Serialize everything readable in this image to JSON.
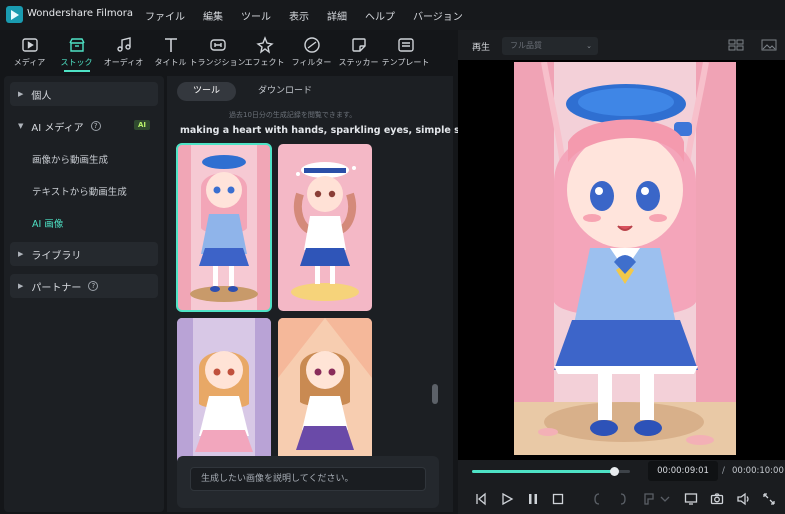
{
  "app": {
    "name": "Wondershare Filmora"
  },
  "menu": [
    "ファイル",
    "編集",
    "ツール",
    "表示",
    "詳細",
    "ヘルプ",
    "バージョン"
  ],
  "toolbar": [
    {
      "label": "メディア",
      "icon": "media-icon"
    },
    {
      "label": "ストック",
      "icon": "stock-icon",
      "active": true
    },
    {
      "label": "オーディオ",
      "icon": "audio-icon"
    },
    {
      "label": "タイトル",
      "icon": "title-icon"
    },
    {
      "label": "トランジション",
      "icon": "transition-icon"
    },
    {
      "label": "エフェクト",
      "icon": "effect-icon"
    },
    {
      "label": "フィルター",
      "icon": "filter-icon"
    },
    {
      "label": "ステッカー",
      "icon": "sticker-icon"
    },
    {
      "label": "テンプレート",
      "icon": "template-icon"
    }
  ],
  "nav": {
    "personal": "個人",
    "ai_media": "AI メディア",
    "ai_badge": "AI",
    "sub_items": [
      "画像から動画生成",
      "テキストから動画生成",
      "AI 画像"
    ],
    "active_sub": "AI 画像",
    "library": "ライブラリ",
    "partner": "パートナー"
  },
  "panel": {
    "tabs": [
      "ツール",
      "ダウンロード"
    ],
    "active_tab": "ツール",
    "notice": "過去10日分の生成記録を閲覧できます。",
    "prompt": "making a heart with hands, sparkling eyes, simple sta...",
    "input_placeholder": "生成したい画像を説明してください。"
  },
  "preview": {
    "label": "再生",
    "quality": "フル品質",
    "current_time": "00:00:09:01",
    "separator": "/",
    "total_time": "00:00:10:00",
    "progress": 0.9
  },
  "colors": {
    "accent": "#4ee2c5",
    "background": "#141619",
    "panel": "#1c1f23"
  }
}
